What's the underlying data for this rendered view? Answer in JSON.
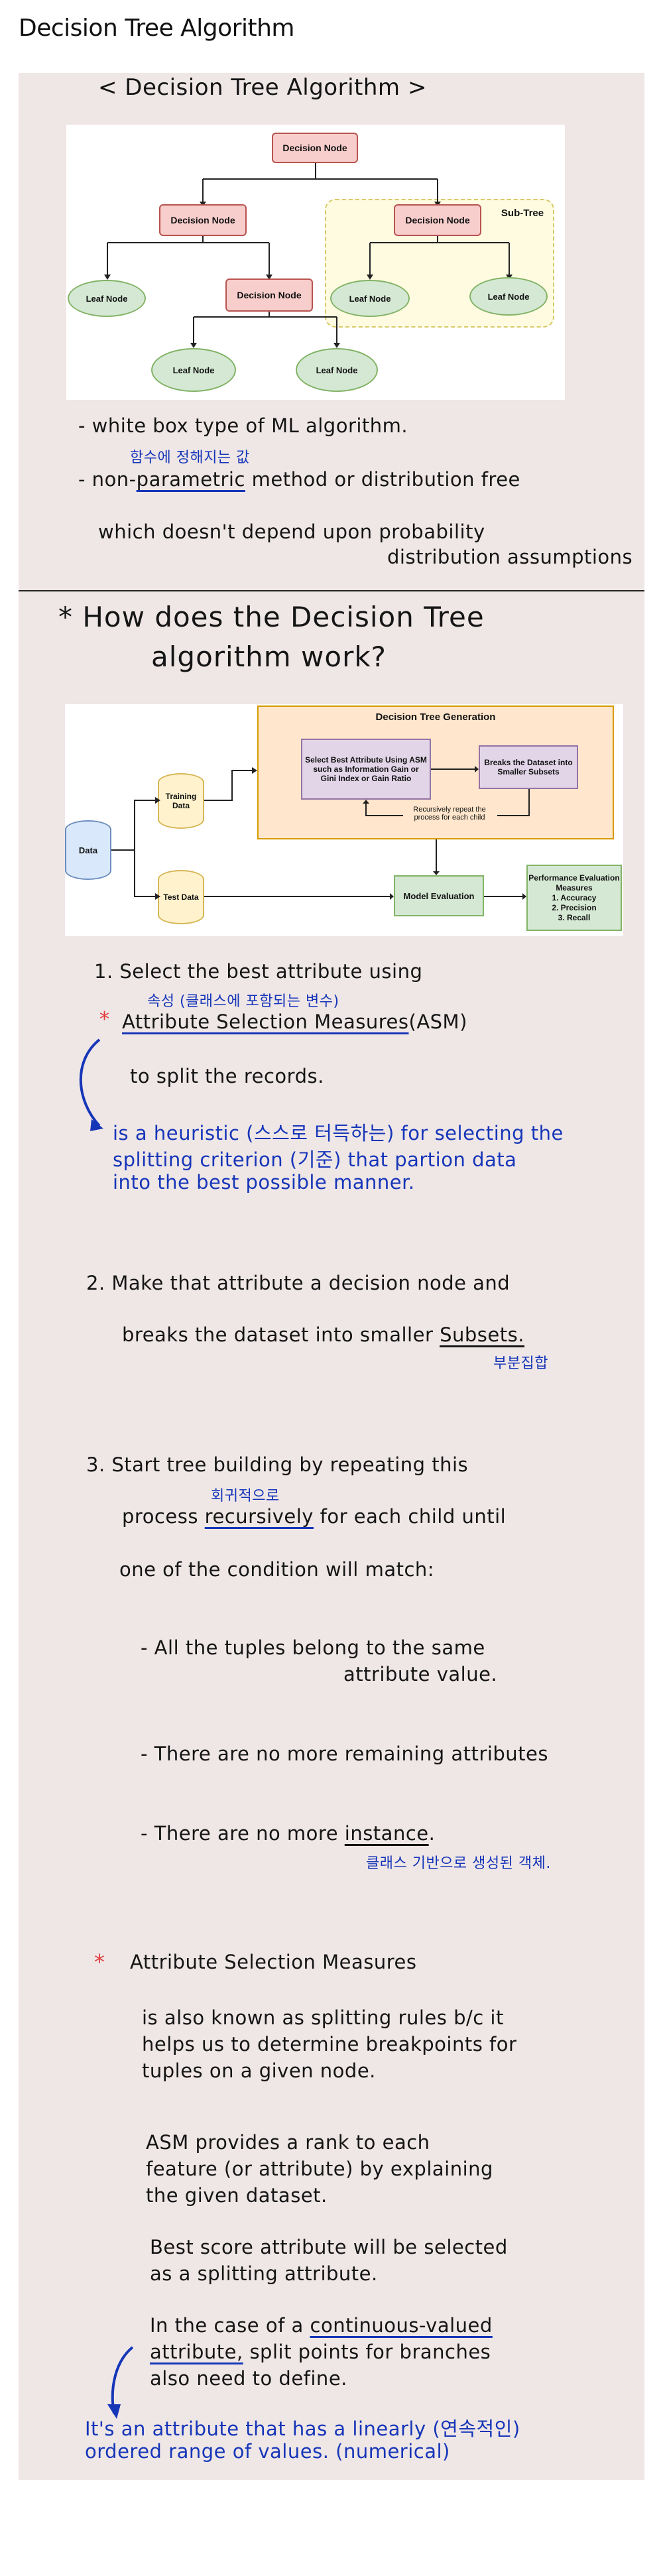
{
  "page_title": "Decision Tree Algorithm",
  "section1": {
    "heading": "< Decision Tree Algorithm >",
    "diagram": {
      "decision_node": "Decision Node",
      "leaf_node": "Leaf Node",
      "sub_tree": "Sub-Tree"
    },
    "bullet1": "- white box type of ML algorithm.",
    "bullet2_prefix": "- non-",
    "bullet2_underlined": "parametric",
    "bullet2_suffix": "method or distribution free",
    "bullet2_note": "함수에 정해지는 값",
    "bullet2_line2": "which doesn't depend upon probability",
    "bullet2_line3": "distribution assumptions"
  },
  "section2": {
    "heading_line1": "* How does the Decision Tree",
    "heading_line2": "algorithm work?",
    "flow": {
      "generation_title": "Decision Tree Generation",
      "select_attr": "Select Best Attribute Using ASM such as Information Gain or Gini Index or Gain Ratio",
      "breaks": "Breaks the Dataset into Smaller Subsets",
      "recursive": "Recursively repeat the process for each child",
      "data": "Data",
      "training": "Training Data",
      "test": "Test Data",
      "model_eval": "Model Evaluation",
      "perf": "Performance Evaluation Measures",
      "perf_items": [
        "1. Accuracy",
        "2. Precision",
        "3. Recall"
      ]
    },
    "step1_line1": "1. Select the best attribute using",
    "step1_note": "속성 (클래스에 포함되는 변수)",
    "step1_asm": "Attribute Selection Measures",
    "step1_asm_abbr": "(ASM)",
    "step1_line3": "to split the records.",
    "step1_blue1": "is a heuristic (스스로 터득하는) for selecting the",
    "step1_blue2": "splitting criterion (기준) that partion data",
    "step1_blue3": "into the best possible manner.",
    "step2_line1": "2. Make that attribute a decision node and",
    "step2_line2_prefix": "breaks the dataset into smaller",
    "step2_subsets": "Subsets.",
    "step2_note": "부분집합",
    "step3_line1": "3. Start tree building by repeating this",
    "step3_note": "회귀적으로",
    "step3_line2_prefix": "process",
    "step3_recursively": "recursively",
    "step3_line2_suffix": "for each child until",
    "step3_line3": "one of the condition will match:",
    "cond1_line1": "- All the tuples belong to the same",
    "cond1_line2": "attribute value.",
    "cond2": "- There are no more remaining attributes",
    "cond3_prefix": "- There are no more",
    "cond3_instance": "instance",
    "cond3_note": "클래스 기반으로 생성된 객체."
  },
  "section3": {
    "star": "*",
    "heading": "Attribute Selection Measures",
    "p1": [
      "is also known as splitting rules b/c it",
      "helps us to determine breakpoints for",
      "tuples on a given node."
    ],
    "p2": [
      "ASM provides a rank to each",
      "feature (or attribute) by explaining",
      "the given dataset."
    ],
    "p3": [
      "Best score attribute will be selected",
      "as a splitting attribute."
    ],
    "p4_line1_prefix": "In the case of a",
    "p4_cv": "continuous-valued",
    "p4_line2_attr": "attribute,",
    "p4_line2_rest": "split points for branches",
    "p4_line3": "also need to define.",
    "blue1": "It's an attribute that has a linearly (연속적인)",
    "blue2": "ordered range of values. (numerical)"
  }
}
